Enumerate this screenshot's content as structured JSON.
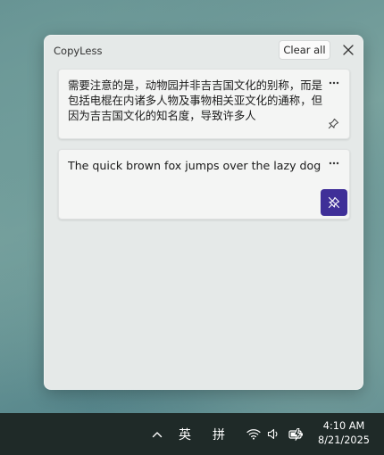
{
  "app": {
    "title": "CopyLess",
    "clear_label": "Clear all",
    "close_icon": "close-icon"
  },
  "clips": [
    {
      "text": "需要注意的是，动物园并非吉吉国文化的别称，而是包括电棍在内诸多人物及事物相关亚文化的通称，但因为吉吉国文化的知名度，导致许多人",
      "pinned": false,
      "more_icon": "more-icon",
      "pin_icon": "pin-icon"
    },
    {
      "text": "The quick brown fox jumps over the lazy dog",
      "pinned": true,
      "more_icon": "more-icon",
      "pin_icon": "unpin-icon"
    }
  ],
  "colors": {
    "accent": "#3f2f98",
    "panel": "#e5e9e8",
    "taskbar": "#1f2a28"
  },
  "taskbar": {
    "overflow_icon": "chevron-up-icon",
    "ime_lang": "英",
    "ime_mode": "拼",
    "wifi_icon": "wifi-icon",
    "volume_icon": "volume-icon",
    "battery_icon": "battery-charging-icon",
    "time": "4:10 AM",
    "date": "8/21/2025"
  }
}
